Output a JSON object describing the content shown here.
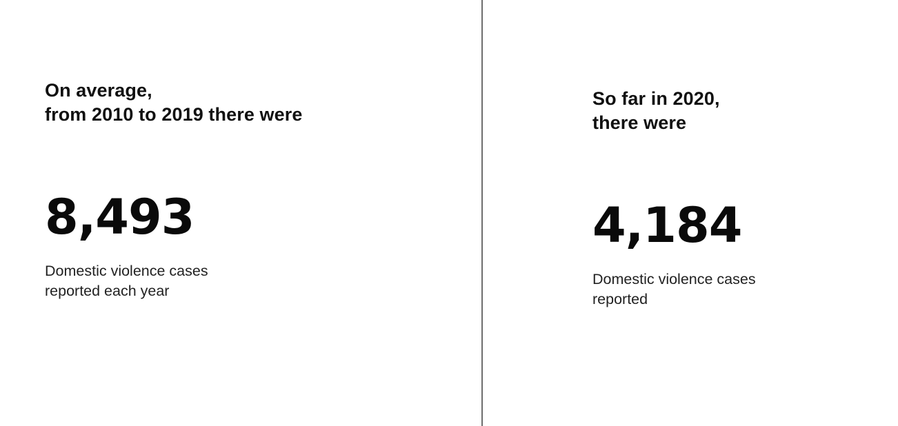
{
  "left": {
    "heading_line1": "On average,",
    "heading_line2": "from 2010 to 2019 there were",
    "number": "8,493",
    "caption_line1": "Domestic violence cases",
    "caption_line2": "reported each year"
  },
  "right": {
    "heading_line1": "So far in 2020,",
    "heading_line2": "there were",
    "number": "4,184",
    "caption_line1": "Domestic violence cases",
    "caption_line2": "reported"
  },
  "colors": {
    "text": "#111111",
    "divider": "#6e6e6e",
    "background": "#ffffff"
  }
}
